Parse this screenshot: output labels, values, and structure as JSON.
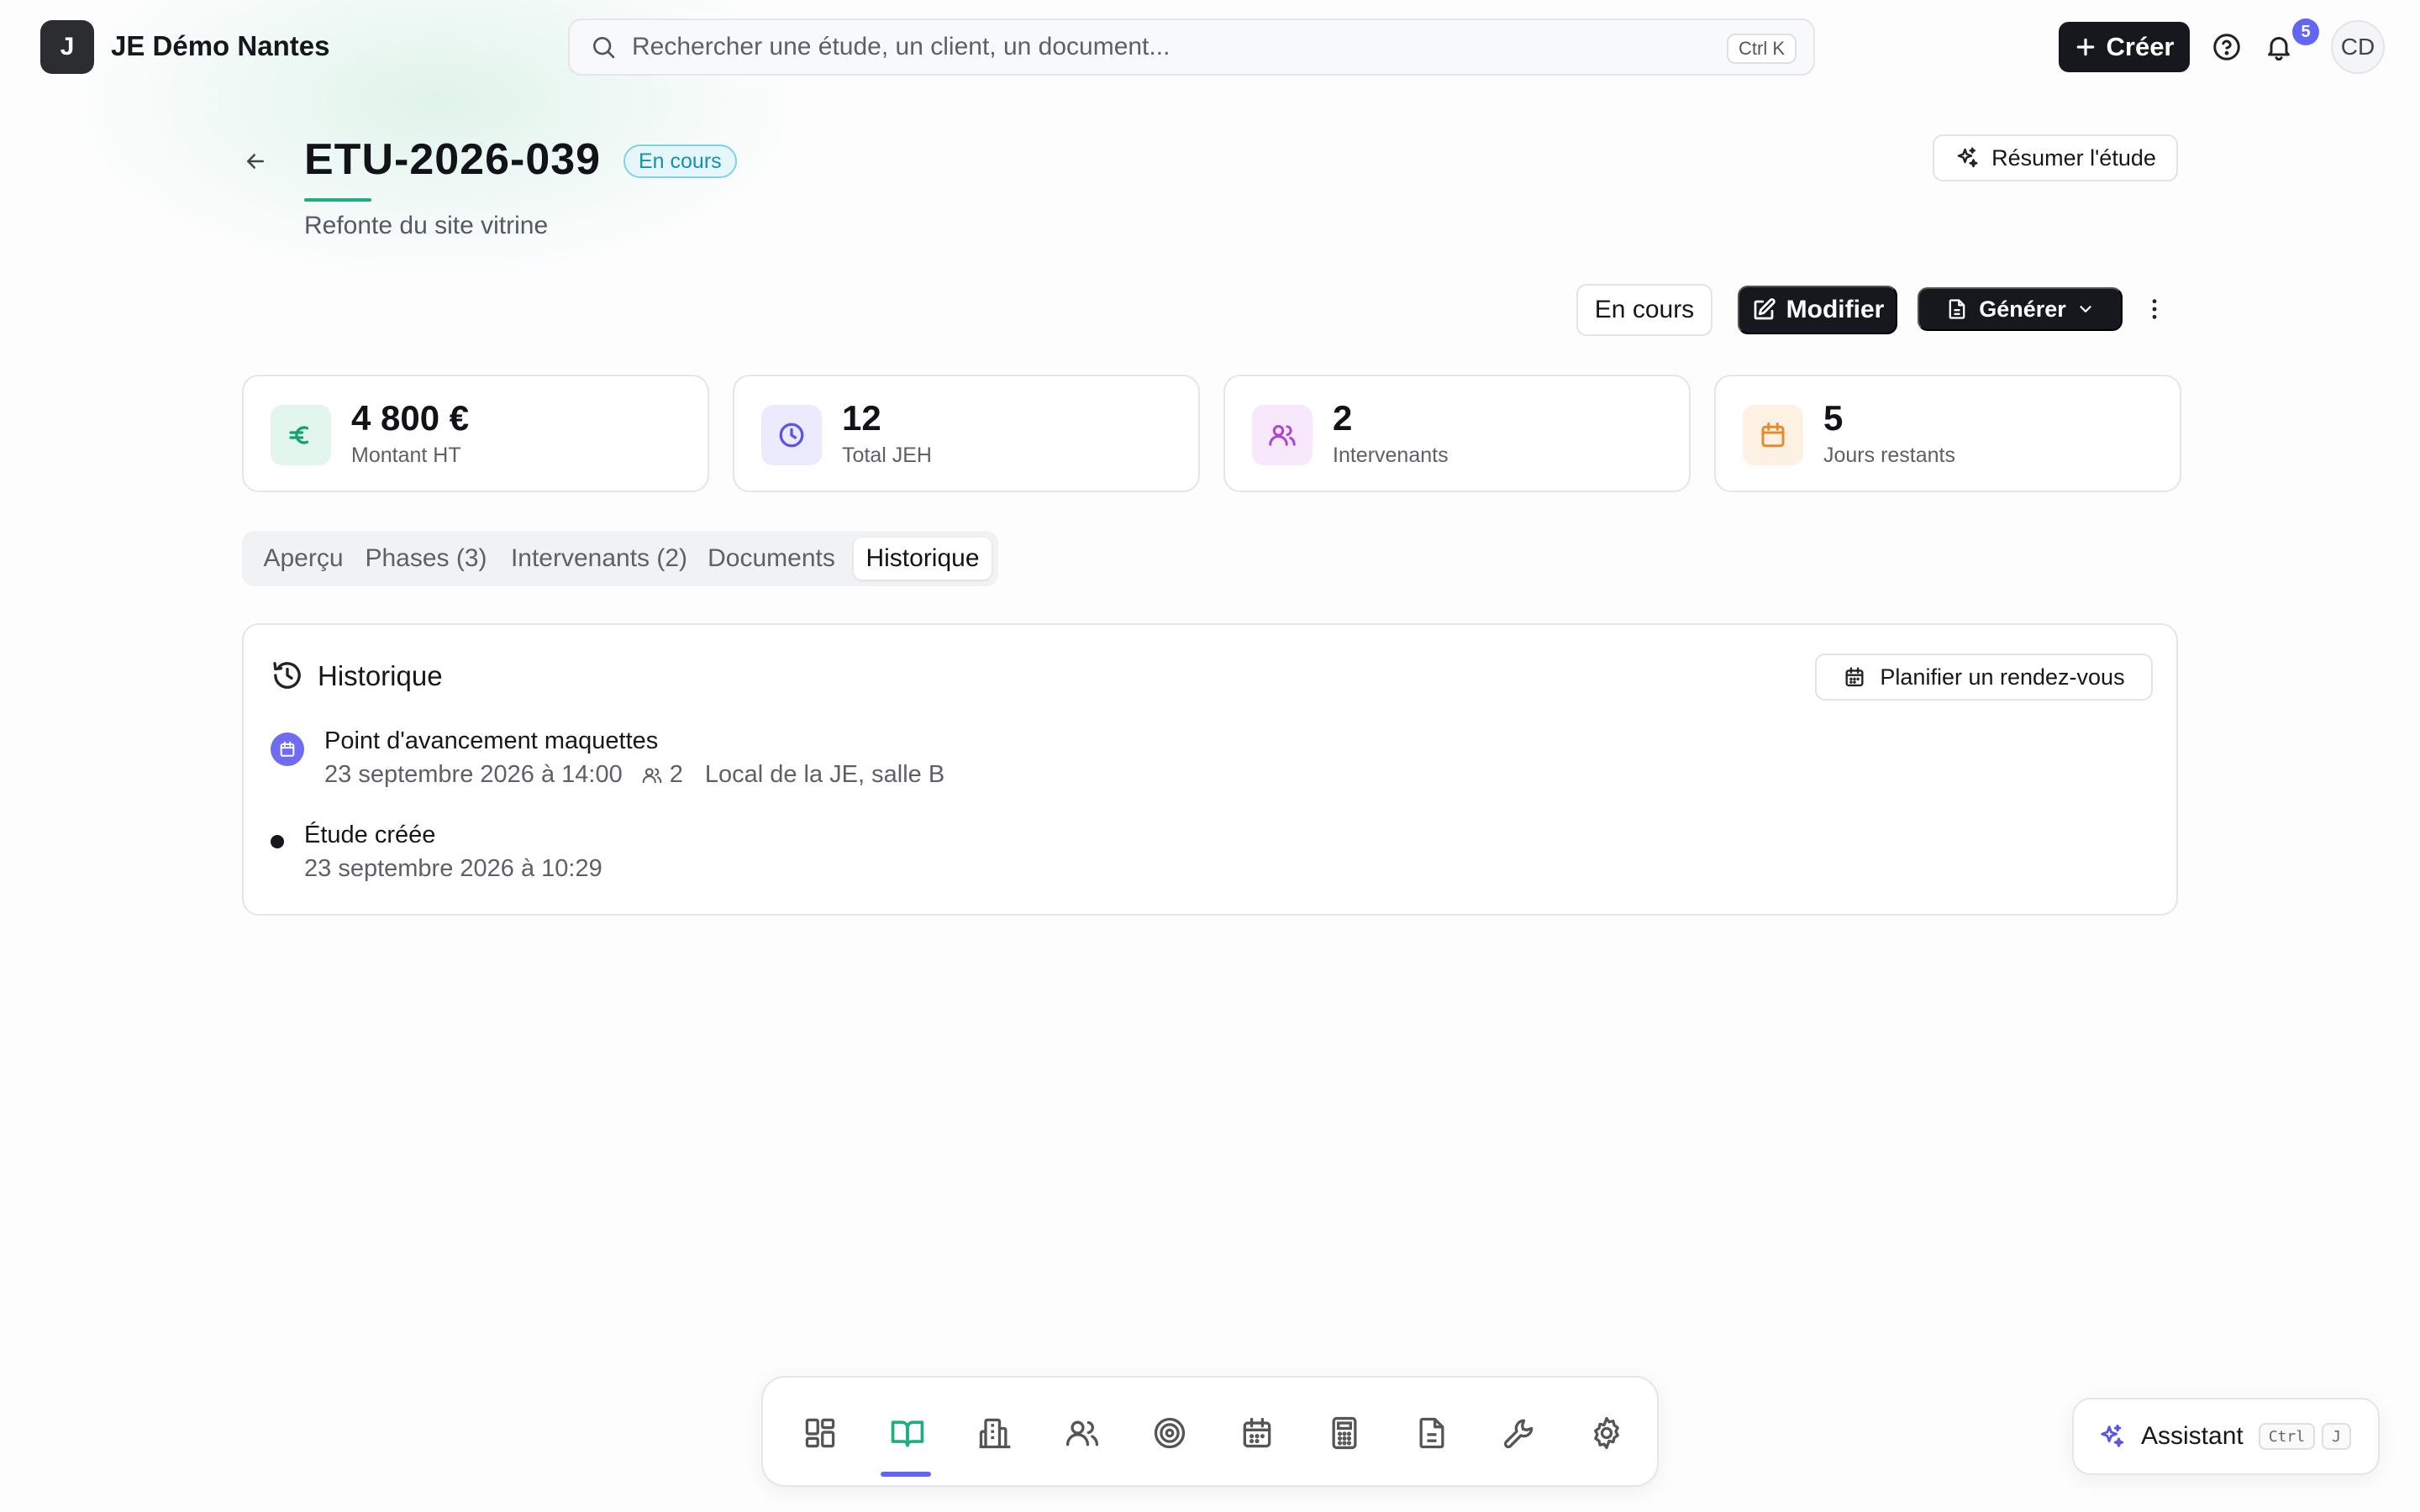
{
  "header": {
    "logo_letter": "J",
    "org_name": "JE Démo Nantes",
    "search_placeholder": "Rechercher une étude, un client, un document...",
    "search_shortcut": "Ctrl K",
    "create_label": "Créer",
    "notification_count": "5",
    "avatar_initials": "CD"
  },
  "study": {
    "id": "ETU-2026-039",
    "status": "En cours",
    "subtitle": "Refonte du site vitrine",
    "summary_button": "Résumer l'étude"
  },
  "actions": {
    "status_button": "En cours",
    "edit_button": "Modifier",
    "generate_button": "Générer"
  },
  "stats": [
    {
      "value": "4 800 €",
      "label": "Montant HT",
      "icon": "euro-icon",
      "color": "#12a36f"
    },
    {
      "value": "12",
      "label": "Total JEH",
      "icon": "clock-icon",
      "color": "#5b54e8"
    },
    {
      "value": "2",
      "label": "Intervenants",
      "icon": "users-icon",
      "color": "#b043d6"
    },
    {
      "value": "5",
      "label": "Jours restants",
      "icon": "calendar-icon",
      "color": "#e8892b"
    }
  ],
  "tabs": [
    {
      "label": "Aperçu"
    },
    {
      "label": "Phases (3)"
    },
    {
      "label": "Intervenants (2)"
    },
    {
      "label": "Documents"
    },
    {
      "label": "Historique",
      "active": true
    }
  ],
  "history": {
    "title": "Historique",
    "plan_button": "Planifier un rendez-vous",
    "events": [
      {
        "title": "Point d'avancement maquettes",
        "date": "23 septembre 2026 à 14:00",
        "participants": "2",
        "location": "Local de la JE, salle B"
      },
      {
        "title": "Étude créée",
        "date": "23 septembre 2026 à 10:29"
      }
    ]
  },
  "dock": {
    "items": [
      "dashboard-icon",
      "book-open-icon",
      "building-icon",
      "users-icon",
      "target-icon",
      "calendar-icon",
      "calculator-icon",
      "file-text-icon",
      "wrench-icon",
      "settings-icon"
    ],
    "active": "book-open-icon"
  },
  "assistant": {
    "label": "Assistant",
    "shortcut_ctrl": "Ctrl",
    "shortcut_key": "J"
  },
  "colors": {
    "accent_green": "#1fae7e",
    "accent_indigo": "#6366f1",
    "dark": "#16181d"
  }
}
